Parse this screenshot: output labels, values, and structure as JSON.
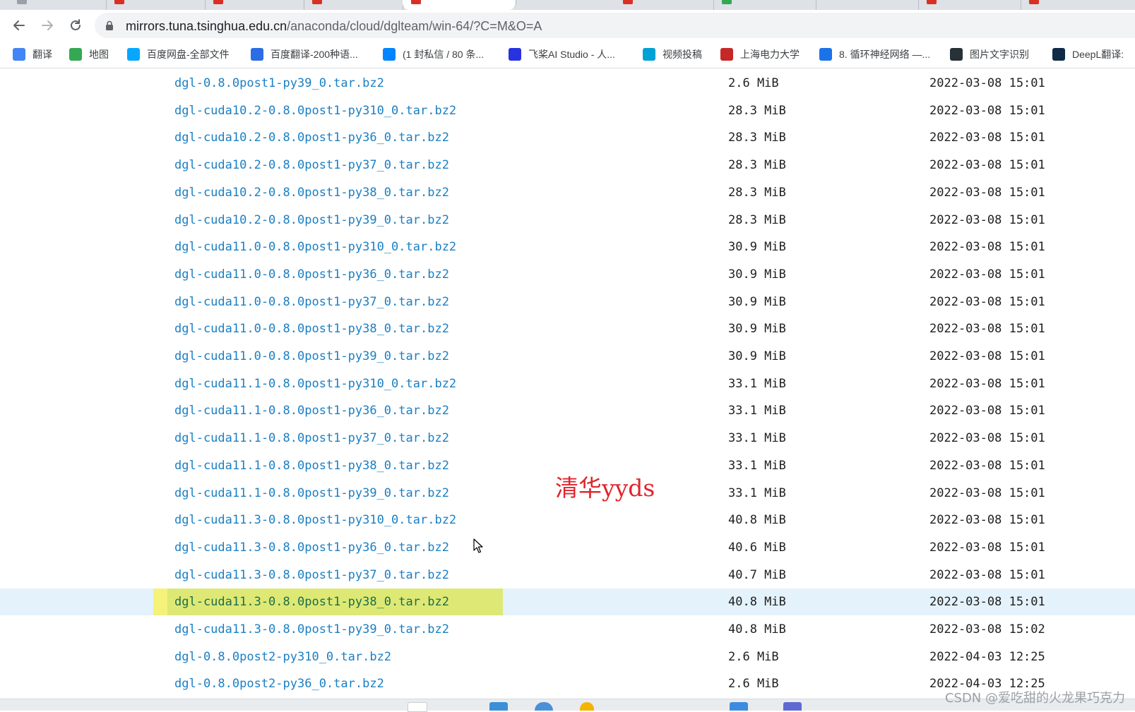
{
  "browser": {
    "url_host": "mirrors.tuna.tsinghua.edu.cn",
    "url_path": "/anaconda/cloud/dglteam/win-64/?C=M&O=A",
    "bookmarks": [
      {
        "label": "翻译",
        "icon": "google-translate-icon",
        "color": "#4285f4"
      },
      {
        "label": "地图",
        "icon": "maps-icon",
        "color": "#34a853"
      },
      {
        "label": "百度网盘-全部文件",
        "icon": "baidu-pan-icon",
        "color": "#06a7ff"
      },
      {
        "label": "百度翻译-200种语...",
        "icon": "translate-icon",
        "color": "#2b6de5"
      },
      {
        "label": "(1 封私信 / 80 条...",
        "icon": "zhihu-icon",
        "color": "#0084ff"
      },
      {
        "label": "飞桨AI Studio - 人...",
        "icon": "paddle-icon",
        "color": "#2932e1"
      },
      {
        "label": "视频投稿",
        "icon": "bilibili-icon",
        "color": "#00a1d6"
      },
      {
        "label": "上海电力大学",
        "icon": "university-icon",
        "color": "#c62828"
      },
      {
        "label": "8. 循环神经网络 —...",
        "icon": "notebook-icon",
        "color": "#1a73e8"
      },
      {
        "label": "图片文字识别",
        "icon": "ocr-icon",
        "color": "#263238"
      },
      {
        "label": "DeepL翻译:",
        "icon": "deepl-icon",
        "color": "#0f2b46"
      }
    ]
  },
  "files": [
    {
      "name": "dgl-0.8.0post1-py39_0.tar.bz2",
      "size": "2.6 MiB",
      "date": "2022-03-08 15:01"
    },
    {
      "name": "dgl-cuda10.2-0.8.0post1-py310_0.tar.bz2",
      "size": "28.3 MiB",
      "date": "2022-03-08 15:01"
    },
    {
      "name": "dgl-cuda10.2-0.8.0post1-py36_0.tar.bz2",
      "size": "28.3 MiB",
      "date": "2022-03-08 15:01"
    },
    {
      "name": "dgl-cuda10.2-0.8.0post1-py37_0.tar.bz2",
      "size": "28.3 MiB",
      "date": "2022-03-08 15:01"
    },
    {
      "name": "dgl-cuda10.2-0.8.0post1-py38_0.tar.bz2",
      "size": "28.3 MiB",
      "date": "2022-03-08 15:01"
    },
    {
      "name": "dgl-cuda10.2-0.8.0post1-py39_0.tar.bz2",
      "size": "28.3 MiB",
      "date": "2022-03-08 15:01"
    },
    {
      "name": "dgl-cuda11.0-0.8.0post1-py310_0.tar.bz2",
      "size": "30.9 MiB",
      "date": "2022-03-08 15:01"
    },
    {
      "name": "dgl-cuda11.0-0.8.0post1-py36_0.tar.bz2",
      "size": "30.9 MiB",
      "date": "2022-03-08 15:01"
    },
    {
      "name": "dgl-cuda11.0-0.8.0post1-py37_0.tar.bz2",
      "size": "30.9 MiB",
      "date": "2022-03-08 15:01"
    },
    {
      "name": "dgl-cuda11.0-0.8.0post1-py38_0.tar.bz2",
      "size": "30.9 MiB",
      "date": "2022-03-08 15:01"
    },
    {
      "name": "dgl-cuda11.0-0.8.0post1-py39_0.tar.bz2",
      "size": "30.9 MiB",
      "date": "2022-03-08 15:01"
    },
    {
      "name": "dgl-cuda11.1-0.8.0post1-py310_0.tar.bz2",
      "size": "33.1 MiB",
      "date": "2022-03-08 15:01"
    },
    {
      "name": "dgl-cuda11.1-0.8.0post1-py36_0.tar.bz2",
      "size": "33.1 MiB",
      "date": "2022-03-08 15:01"
    },
    {
      "name": "dgl-cuda11.1-0.8.0post1-py37_0.tar.bz2",
      "size": "33.1 MiB",
      "date": "2022-03-08 15:01"
    },
    {
      "name": "dgl-cuda11.1-0.8.0post1-py38_0.tar.bz2",
      "size": "33.1 MiB",
      "date": "2022-03-08 15:01"
    },
    {
      "name": "dgl-cuda11.1-0.8.0post1-py39_0.tar.bz2",
      "size": "33.1 MiB",
      "date": "2022-03-08 15:01"
    },
    {
      "name": "dgl-cuda11.3-0.8.0post1-py310_0.tar.bz2",
      "size": "40.8 MiB",
      "date": "2022-03-08 15:01"
    },
    {
      "name": "dgl-cuda11.3-0.8.0post1-py36_0.tar.bz2",
      "size": "40.6 MiB",
      "date": "2022-03-08 15:01"
    },
    {
      "name": "dgl-cuda11.3-0.8.0post1-py37_0.tar.bz2",
      "size": "40.7 MiB",
      "date": "2022-03-08 15:01"
    },
    {
      "name": "dgl-cuda11.3-0.8.0post1-py38_0.tar.bz2",
      "size": "40.8 MiB",
      "date": "2022-03-08 15:01",
      "selected": true
    },
    {
      "name": "dgl-cuda11.3-0.8.0post1-py39_0.tar.bz2",
      "size": "40.8 MiB",
      "date": "2022-03-08 15:02"
    },
    {
      "name": "dgl-0.8.0post2-py310_0.tar.bz2",
      "size": "2.6 MiB",
      "date": "2022-04-03 12:25"
    },
    {
      "name": "dgl-0.8.0post2-py36_0.tar.bz2",
      "size": "2.6 MiB",
      "date": "2022-04-03 12:25"
    }
  ],
  "annotation": "清华yyds",
  "watermark": "CSDN @爱吃甜的火龙果巧克力",
  "colors": {
    "link": "#1a7fc4",
    "highlight": "#dde974",
    "selected_row": "#e3f2fb",
    "annotation": "#e0242c"
  }
}
